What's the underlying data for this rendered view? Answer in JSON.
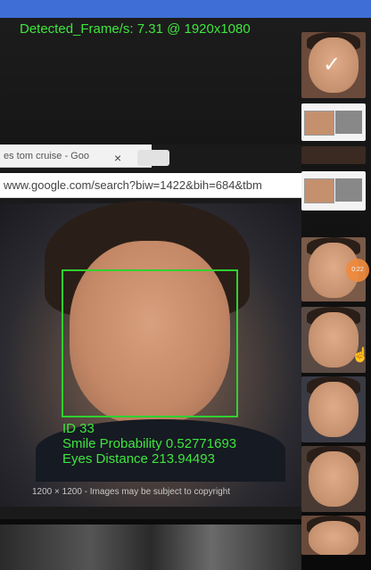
{
  "overlay": {
    "fps_text": "Detected_Frame/s: 7.31 @ 1920x1080",
    "face_id": "ID 33",
    "smile_probability": "Smile Probability 0.52771693",
    "eyes_distance": "Eyes Distance 213.94493"
  },
  "screen": {
    "tab_title": "es tom cruise - Goo",
    "tab_close": "×",
    "address": "www.google.com/search?biw=1422&bih=684&tbm",
    "image_caption": "1200 × 1200 - Images may be subject to copyright"
  },
  "thumbnail_badge": "0:22",
  "icons": {
    "check": "check-icon",
    "cursor": "hand-cursor-icon"
  },
  "colors": {
    "overlay_text": "#3ee63e",
    "face_box": "#2fd12f",
    "status_bar": "#3f6fd6",
    "badge": "#f08a3c"
  }
}
